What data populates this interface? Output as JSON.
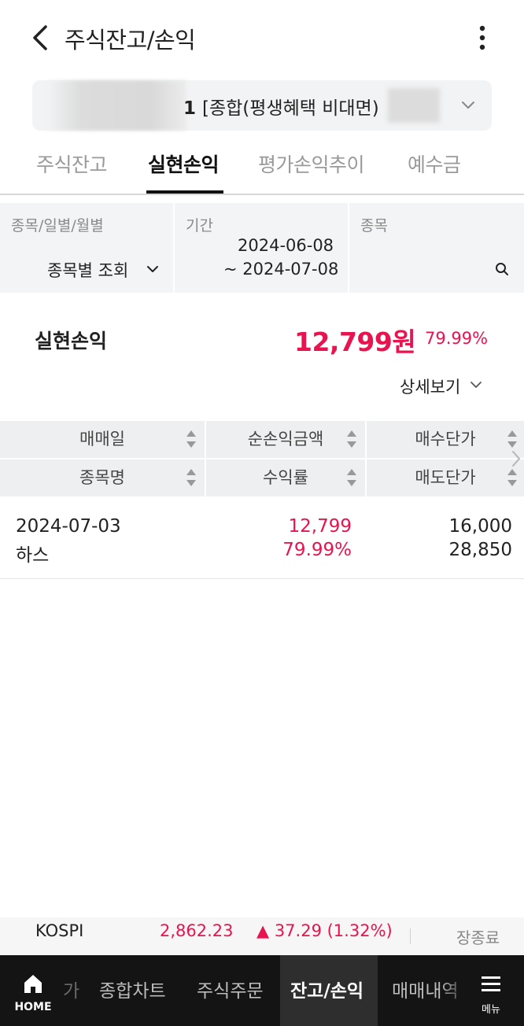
{
  "header": {
    "title": "주식잔고/손익",
    "back_icon": "chevron-left-icon",
    "more_icon": "more-vertical-icon"
  },
  "account": {
    "number_suffix": "1",
    "type": "[종합(평생혜택 비대면)",
    "dropdown_icon": "chevron-down-icon"
  },
  "tabs": [
    {
      "label": "주식잔고",
      "active": false
    },
    {
      "label": "실현손익",
      "active": true
    },
    {
      "label": "평가손익추이",
      "active": false
    },
    {
      "label": "예수금",
      "active": false
    }
  ],
  "filters": {
    "mode": {
      "label": "종목/일별/월별",
      "value": "종목별 조회"
    },
    "period": {
      "label": "기간",
      "start": "2024-06-08",
      "end": "~ 2024-07-08"
    },
    "stock": {
      "label": "종목",
      "icon": "search-icon"
    }
  },
  "summary": {
    "label": "실현손익",
    "amount": "12,799원",
    "rate": "79.99%",
    "detail_label": "상세보기"
  },
  "table": {
    "headers_row1": [
      "매매일",
      "순손익금액",
      "매수단가"
    ],
    "headers_row2": [
      "종목명",
      "수익률",
      "매도단가"
    ],
    "rows": [
      {
        "date": "2024-07-03",
        "name": "하스",
        "net_profit": "12,799",
        "return_rate": "79.99%",
        "buy_price": "16,000",
        "sell_price": "28,850"
      }
    ]
  },
  "ticker": {
    "index": "KOSPI",
    "value": "2,862.23",
    "change": "▲ 37.29 (1.32%)",
    "status": "장종료"
  },
  "bottom_nav": {
    "home": "HOME",
    "partial_left": "가",
    "items": [
      "종합차트",
      "주식주문",
      "잔고/손익",
      "매매내역"
    ],
    "active": "잔고/손익",
    "menu": "메뉴"
  },
  "colors": {
    "positive": "#e8144f",
    "nav_bg": "#141414",
    "filter_bg": "#f3f4f5"
  }
}
